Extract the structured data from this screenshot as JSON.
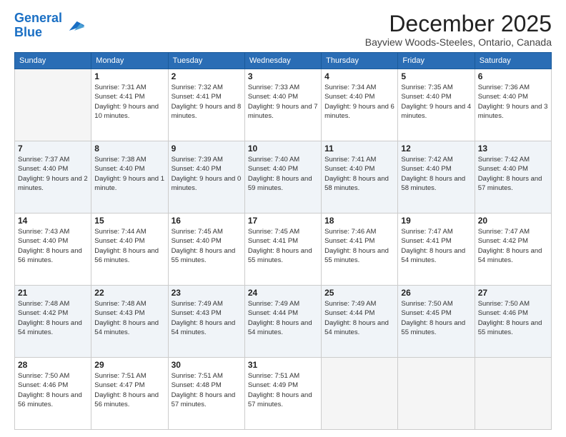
{
  "header": {
    "logo_general": "General",
    "logo_blue": "Blue",
    "month_title": "December 2025",
    "location": "Bayview Woods-Steeles, Ontario, Canada"
  },
  "weekdays": [
    "Sunday",
    "Monday",
    "Tuesday",
    "Wednesday",
    "Thursday",
    "Friday",
    "Saturday"
  ],
  "weeks": [
    [
      {
        "date": "",
        "empty": true
      },
      {
        "date": "1",
        "sunrise": "7:31 AM",
        "sunset": "4:41 PM",
        "daylight": "9 hours and 10 minutes."
      },
      {
        "date": "2",
        "sunrise": "7:32 AM",
        "sunset": "4:41 PM",
        "daylight": "9 hours and 8 minutes."
      },
      {
        "date": "3",
        "sunrise": "7:33 AM",
        "sunset": "4:40 PM",
        "daylight": "9 hours and 7 minutes."
      },
      {
        "date": "4",
        "sunrise": "7:34 AM",
        "sunset": "4:40 PM",
        "daylight": "9 hours and 6 minutes."
      },
      {
        "date": "5",
        "sunrise": "7:35 AM",
        "sunset": "4:40 PM",
        "daylight": "9 hours and 4 minutes."
      },
      {
        "date": "6",
        "sunrise": "7:36 AM",
        "sunset": "4:40 PM",
        "daylight": "9 hours and 3 minutes."
      }
    ],
    [
      {
        "date": "7",
        "sunrise": "7:37 AM",
        "sunset": "4:40 PM",
        "daylight": "9 hours and 2 minutes."
      },
      {
        "date": "8",
        "sunrise": "7:38 AM",
        "sunset": "4:40 PM",
        "daylight": "9 hours and 1 minute."
      },
      {
        "date": "9",
        "sunrise": "7:39 AM",
        "sunset": "4:40 PM",
        "daylight": "9 hours and 0 minutes."
      },
      {
        "date": "10",
        "sunrise": "7:40 AM",
        "sunset": "4:40 PM",
        "daylight": "8 hours and 59 minutes."
      },
      {
        "date": "11",
        "sunrise": "7:41 AM",
        "sunset": "4:40 PM",
        "daylight": "8 hours and 58 minutes."
      },
      {
        "date": "12",
        "sunrise": "7:42 AM",
        "sunset": "4:40 PM",
        "daylight": "8 hours and 58 minutes."
      },
      {
        "date": "13",
        "sunrise": "7:42 AM",
        "sunset": "4:40 PM",
        "daylight": "8 hours and 57 minutes."
      }
    ],
    [
      {
        "date": "14",
        "sunrise": "7:43 AM",
        "sunset": "4:40 PM",
        "daylight": "8 hours and 56 minutes."
      },
      {
        "date": "15",
        "sunrise": "7:44 AM",
        "sunset": "4:40 PM",
        "daylight": "8 hours and 56 minutes."
      },
      {
        "date": "16",
        "sunrise": "7:45 AM",
        "sunset": "4:40 PM",
        "daylight": "8 hours and 55 minutes."
      },
      {
        "date": "17",
        "sunrise": "7:45 AM",
        "sunset": "4:41 PM",
        "daylight": "8 hours and 55 minutes."
      },
      {
        "date": "18",
        "sunrise": "7:46 AM",
        "sunset": "4:41 PM",
        "daylight": "8 hours and 55 minutes."
      },
      {
        "date": "19",
        "sunrise": "7:47 AM",
        "sunset": "4:41 PM",
        "daylight": "8 hours and 54 minutes."
      },
      {
        "date": "20",
        "sunrise": "7:47 AM",
        "sunset": "4:42 PM",
        "daylight": "8 hours and 54 minutes."
      }
    ],
    [
      {
        "date": "21",
        "sunrise": "7:48 AM",
        "sunset": "4:42 PM",
        "daylight": "8 hours and 54 minutes."
      },
      {
        "date": "22",
        "sunrise": "7:48 AM",
        "sunset": "4:43 PM",
        "daylight": "8 hours and 54 minutes."
      },
      {
        "date": "23",
        "sunrise": "7:49 AM",
        "sunset": "4:43 PM",
        "daylight": "8 hours and 54 minutes."
      },
      {
        "date": "24",
        "sunrise": "7:49 AM",
        "sunset": "4:44 PM",
        "daylight": "8 hours and 54 minutes."
      },
      {
        "date": "25",
        "sunrise": "7:49 AM",
        "sunset": "4:44 PM",
        "daylight": "8 hours and 54 minutes."
      },
      {
        "date": "26",
        "sunrise": "7:50 AM",
        "sunset": "4:45 PM",
        "daylight": "8 hours and 55 minutes."
      },
      {
        "date": "27",
        "sunrise": "7:50 AM",
        "sunset": "4:46 PM",
        "daylight": "8 hours and 55 minutes."
      }
    ],
    [
      {
        "date": "28",
        "sunrise": "7:50 AM",
        "sunset": "4:46 PM",
        "daylight": "8 hours and 56 minutes."
      },
      {
        "date": "29",
        "sunrise": "7:51 AM",
        "sunset": "4:47 PM",
        "daylight": "8 hours and 56 minutes."
      },
      {
        "date": "30",
        "sunrise": "7:51 AM",
        "sunset": "4:48 PM",
        "daylight": "8 hours and 57 minutes."
      },
      {
        "date": "31",
        "sunrise": "7:51 AM",
        "sunset": "4:49 PM",
        "daylight": "8 hours and 57 minutes."
      },
      {
        "date": "",
        "empty": true
      },
      {
        "date": "",
        "empty": true
      },
      {
        "date": "",
        "empty": true
      }
    ]
  ]
}
